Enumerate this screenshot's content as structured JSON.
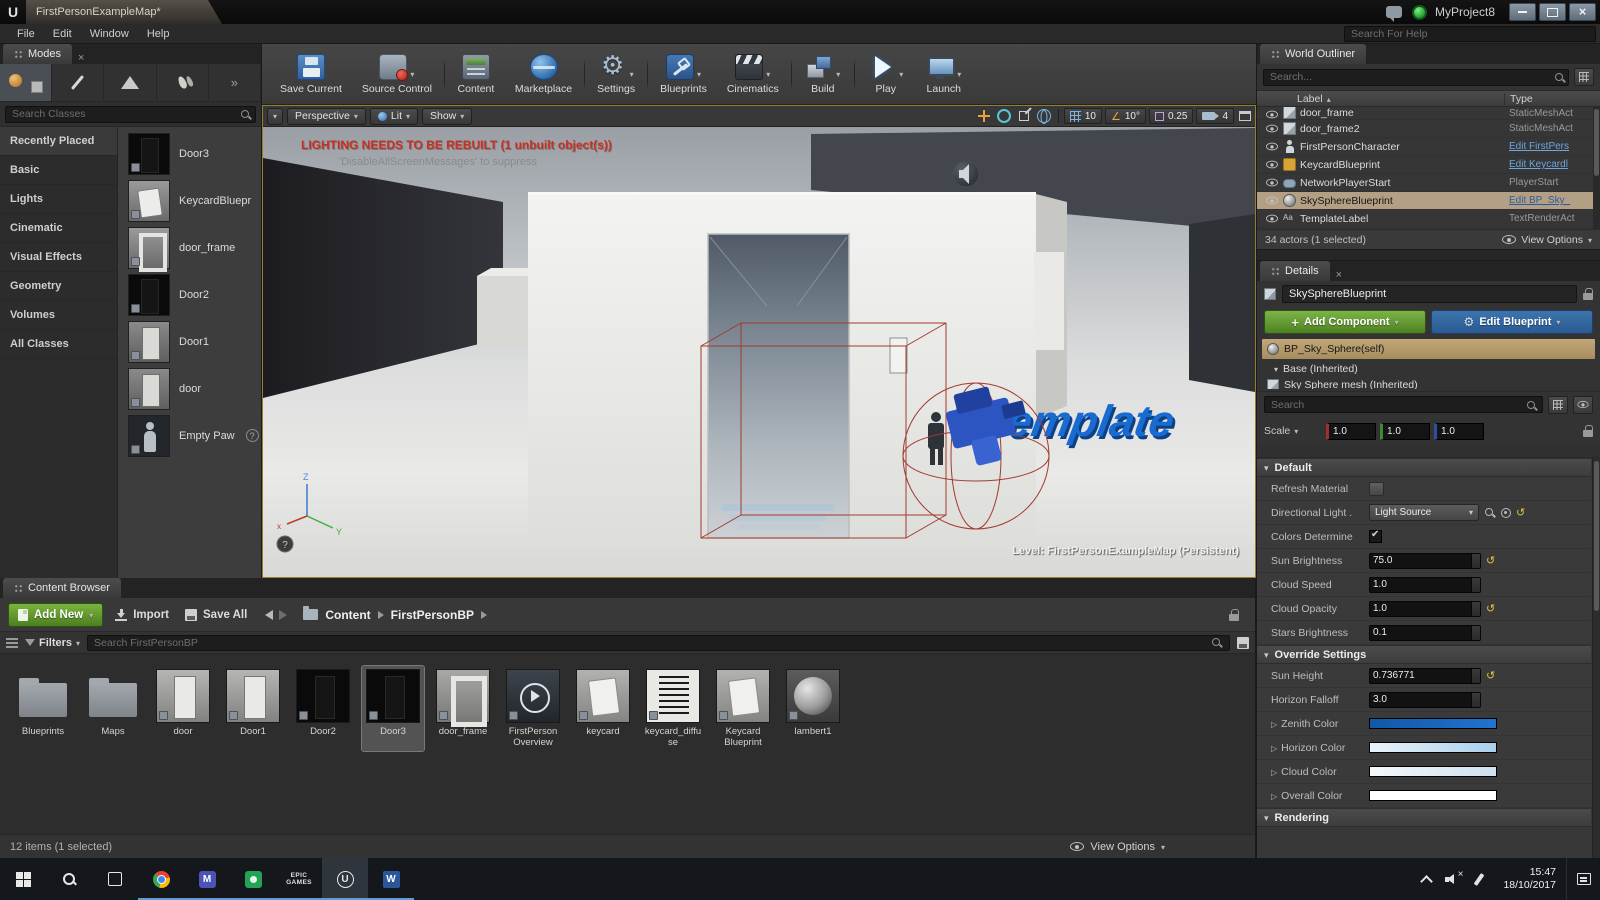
{
  "titlebar": {
    "tab_title": "FirstPersonExampleMap*",
    "project_name": "MyProject8"
  },
  "menubar": {
    "items": [
      {
        "label": "File"
      },
      {
        "label": "Edit"
      },
      {
        "label": "Window"
      },
      {
        "label": "Help"
      }
    ],
    "help_search_placeholder": "Search For Help"
  },
  "modes": {
    "tab_title": "Modes",
    "search_placeholder": "Search Classes",
    "categories": [
      {
        "label": "Recently Placed",
        "selected": true
      },
      {
        "label": "Basic"
      },
      {
        "label": "Lights"
      },
      {
        "label": "Cinematic"
      },
      {
        "label": "Visual Effects"
      },
      {
        "label": "Geometry"
      },
      {
        "label": "Volumes"
      },
      {
        "label": "All Classes"
      }
    ],
    "items": [
      {
        "label": "Door3",
        "kind": "dark"
      },
      {
        "label": "KeycardBluepr",
        "kind": "card"
      },
      {
        "label": "door_frame",
        "kind": "frame"
      },
      {
        "label": "Door2",
        "kind": "dark"
      },
      {
        "label": "Door1",
        "kind": "mid"
      },
      {
        "label": "door",
        "kind": "mid"
      },
      {
        "label": "Empty Paw",
        "kind": "pawn",
        "help": true
      }
    ]
  },
  "toolbar": {
    "buttons": [
      {
        "label": "Save Current",
        "kind": "save"
      },
      {
        "label": "Source Control",
        "kind": "source",
        "dropdown": true,
        "sep": true
      },
      {
        "label": "Content",
        "kind": "content"
      },
      {
        "label": "Marketplace",
        "kind": "market",
        "sep": true
      },
      {
        "label": "Settings",
        "kind": "settings",
        "dropdown": true,
        "sep": true
      },
      {
        "label": "Blueprints",
        "kind": "blueprints",
        "dropdown": true
      },
      {
        "label": "Cinematics",
        "kind": "cinematics",
        "dropdown": true,
        "sep": true
      },
      {
        "label": "Build",
        "kind": "build",
        "dropdown": true,
        "sep": true
      },
      {
        "label": "Play",
        "kind": "play",
        "dropdown": true
      },
      {
        "label": "Launch",
        "kind": "launch",
        "dropdown": true
      }
    ]
  },
  "viewport": {
    "camera_button": "Perspective",
    "view_mode_button": "Lit",
    "show_button": "Show",
    "warning_line1": "LIGHTING NEEDS TO BE REBUILT (1 unbuilt object(s))",
    "warning_line2": "'DisableAllScreenMessages' to suppress",
    "grid_snap_value": "10",
    "rotation_snap_value": "10°",
    "scale_snap_value": "0.25",
    "camera_speed_value": "4",
    "level_label": "Level:  FirstPersonExampleMap (Persistent)",
    "scene_text": "emplate",
    "axis_x": "x",
    "axis_y": "Y",
    "axis_z": "Z",
    "help_glyph": "?"
  },
  "content_browser": {
    "tab_title": "Content Browser",
    "add_new_label": "Add New",
    "import_label": "Import",
    "save_all_label": "Save All",
    "path": [
      {
        "label": "Content"
      },
      {
        "label": "FirstPersonBP"
      }
    ],
    "filters_label": "Filters",
    "search_placeholder": "Search FirstPersonBP",
    "assets": [
      {
        "label": "Blueprints",
        "kind": "folder"
      },
      {
        "label": "Maps",
        "kind": "folder"
      },
      {
        "label": "door",
        "kind": "mesh-light"
      },
      {
        "label": "Door1",
        "kind": "mesh-light"
      },
      {
        "label": "Door2",
        "kind": "mesh-dark"
      },
      {
        "label": "Door3",
        "kind": "mesh-dark",
        "selected": true
      },
      {
        "label": "door_frame",
        "kind": "frame"
      },
      {
        "label": "FirstPerson Overview",
        "kind": "media"
      },
      {
        "label": "keycard",
        "kind": "card"
      },
      {
        "label": "keycard_diffuse",
        "kind": "texture"
      },
      {
        "label": "Keycard Blueprint",
        "kind": "card"
      },
      {
        "label": "lambert1",
        "kind": "material"
      }
    ],
    "status_text": "12 items (1 selected)",
    "view_options_label": "View Options"
  },
  "outliner": {
    "tab_title": "World Outliner",
    "search_placeholder": "Search...",
    "label_column": "Label",
    "type_column": "Type",
    "rows": [
      {
        "label": "door_frame",
        "type": "StaticMeshAct",
        "icon": "mesh",
        "clipped": true
      },
      {
        "label": "door_frame2",
        "type": "StaticMeshAct",
        "icon": "mesh"
      },
      {
        "label": "FirstPersonCharacter",
        "type": "Edit FirstPers",
        "icon": "character",
        "link": true
      },
      {
        "label": "KeycardBlueprint",
        "type": "Edit Keycardl",
        "icon": "blueprint",
        "link": true
      },
      {
        "label": "NetworkPlayerStart",
        "type": "PlayerStart",
        "icon": "playerstart"
      },
      {
        "label": "SkySphereBlueprint",
        "type": "Edit BP_Sky_",
        "icon": "sphere",
        "link": true,
        "selected": true
      },
      {
        "label": "TemplateLabel",
        "type": "TextRenderAct",
        "icon": "text"
      }
    ],
    "status_text": "34 actors (1 selected)",
    "view_options_label": "View Options"
  },
  "details": {
    "tab_title": "Details",
    "name_value": "SkySphereBlueprint",
    "add_component_label": "Add Component",
    "edit_blueprint_label": "Edit Blueprint",
    "component_rows": [
      {
        "label": "BP_Sky_Sphere(self)",
        "icon": "sphere",
        "selected": true
      },
      {
        "label": "Base (Inherited)",
        "icon": "none",
        "expanded": true
      },
      {
        "label": "Sky Sphere mesh (Inherited)",
        "icon": "mesh",
        "clipped": true
      }
    ],
    "search_placeholder": "Search",
    "scale_label": "Scale",
    "scale_values": [
      "1.0",
      "1.0",
      "1.0"
    ],
    "sections": {
      "default": {
        "title": "Default",
        "rows": [
          {
            "label": "Refresh Material",
            "widget": "box"
          },
          {
            "label": "Directional Light .",
            "widget": "dropdown",
            "value": "Light Source",
            "reset": true
          },
          {
            "label": "Colors Determine",
            "widget": "checkbox",
            "checked": true
          },
          {
            "label": "Sun Brightness",
            "widget": "number",
            "value": "75.0",
            "reset": true
          },
          {
            "label": "Cloud Speed",
            "widget": "number",
            "value": "1.0"
          },
          {
            "label": "Cloud Opacity",
            "widget": "number",
            "value": "1.0",
            "reset": true
          },
          {
            "label": "Stars Brightness",
            "widget": "number",
            "value": "0.1"
          }
        ]
      },
      "override": {
        "title": "Override Settings",
        "rows": [
          {
            "label": "Sun Height",
            "widget": "number",
            "value": "0.736771",
            "reset": true
          },
          {
            "label": "Horizon Falloff",
            "widget": "number",
            "value": "3.0"
          },
          {
            "label": "Zenith Color",
            "widget": "color",
            "expand": true,
            "color1": "#1158a8",
            "color2": "#2173cf"
          },
          {
            "label": "Horizon Color",
            "widget": "color",
            "expand": true,
            "color1": "#e9f3fa",
            "color2": "#a9cfec"
          },
          {
            "label": "Cloud Color",
            "widget": "color",
            "expand": true,
            "color1": "#f4f8fc",
            "color2": "#cfe0ee"
          },
          {
            "label": "Overall Color",
            "widget": "color",
            "expand": true,
            "color1": "#ffffff",
            "color2": "#ffffff"
          }
        ]
      },
      "rendering_title": "Rendering"
    }
  },
  "taskbar": {
    "apps": [
      {
        "icon": "search"
      },
      {
        "icon": "taskview"
      },
      {
        "icon": "chrome",
        "running": true
      },
      {
        "icon": "mail",
        "running": true
      },
      {
        "icon": "teams",
        "running": true
      },
      {
        "icon": "epic",
        "label": "EPIC GAMES",
        "running": true
      },
      {
        "icon": "unreal",
        "running": true,
        "active": true
      },
      {
        "icon": "word",
        "running": true
      }
    ],
    "time": "15:47",
    "date": "18/10/2017"
  }
}
